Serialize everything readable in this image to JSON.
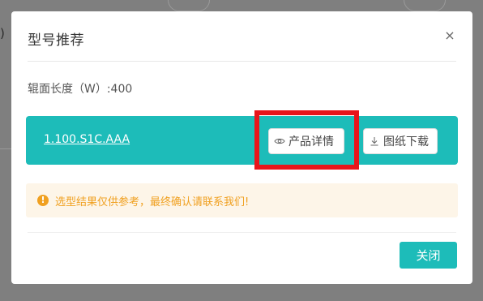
{
  "background": {
    "partial_char": ")"
  },
  "modal": {
    "title": "型号推荐",
    "close_symbol": "×",
    "param_label": "辊面长度（W）:400",
    "result": {
      "model_code": "1.100.S1C.AAA",
      "detail_button": "产品详情",
      "drawing_button": "图纸下载"
    },
    "notice": {
      "icon": "!",
      "text": "选型结果仅供参考，最终确认请联系我们!"
    },
    "footer": {
      "close_button": "关闭"
    }
  },
  "colors": {
    "accent": "#1dbcb9",
    "warning": "#f0a020",
    "highlight": "#e8151b"
  }
}
